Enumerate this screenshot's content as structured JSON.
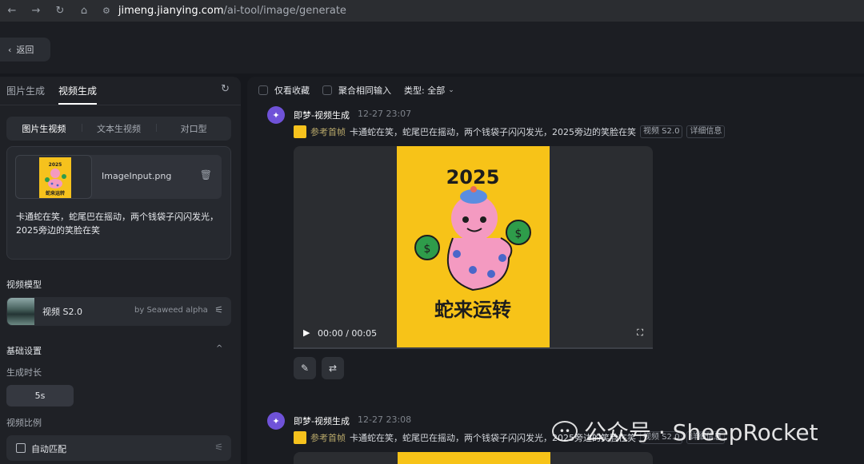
{
  "browser": {
    "url_host": "jimeng.jianying.com",
    "url_path": "/ai-tool/image/generate",
    "icons": [
      "back-arrow-icon",
      "forward-arrow-icon",
      "reload-icon",
      "home-icon",
      "site-settings-icon"
    ]
  },
  "topbar": {
    "back_label": "返回"
  },
  "left_panel": {
    "tabs": [
      {
        "label": "图片生成",
        "active": false
      },
      {
        "label": "视频生成",
        "active": true
      }
    ],
    "modes": [
      {
        "label": "图片生视频",
        "active": true
      },
      {
        "label": "文本生视频",
        "active": false
      },
      {
        "label": "对口型",
        "active": false
      }
    ],
    "input": {
      "filename": "ImageInput.png",
      "prompt": "卡通蛇在笑，蛇尾巴在摇动，两个钱袋子闪闪发光，2025旁边的笑脸在笑",
      "thumb": {
        "year": "2025",
        "caption": "蛇来运转"
      }
    },
    "model_section_label": "视频模型",
    "model": {
      "name": "视频 S2.0",
      "by": "by Seaweed alpha"
    },
    "basic_settings_label": "基础设置",
    "duration_label": "生成时长",
    "duration_value": "5s",
    "ratio_label": "视频比例",
    "ratio_value": "自动匹配"
  },
  "main": {
    "filters": {
      "favorites_only": "仅看收藏",
      "merge_inputs": "聚合相同输入",
      "type_label": "类型: 全部"
    },
    "messages": [
      {
        "agent": "即梦-视频生成",
        "time": "12-27  23:07",
        "ref_label": "参考首帧",
        "prompt": "卡通蛇在笑，蛇尾巴在摇动，两个钱袋子闪闪发光，2025旁边的笑脸在笑",
        "model_tag": "视频 S2.0",
        "detail_tag": "详细信息",
        "video": {
          "year": "2025",
          "caption": "蛇来运转",
          "current": "00:00",
          "separator": "/",
          "duration": "00:05"
        }
      },
      {
        "agent": "即梦-视频生成",
        "time": "12-27  23:08",
        "ref_label": "参考首帧",
        "prompt": "卡通蛇在笑，蛇尾巴在摇动，两个钱袋子闪闪发光，2025旁边的笑脸在笑",
        "model_tag": "视频 S2.0",
        "detail_tag": "详细信息"
      }
    ]
  },
  "watermark": {
    "text": "公众号 · SheepRocket"
  }
}
